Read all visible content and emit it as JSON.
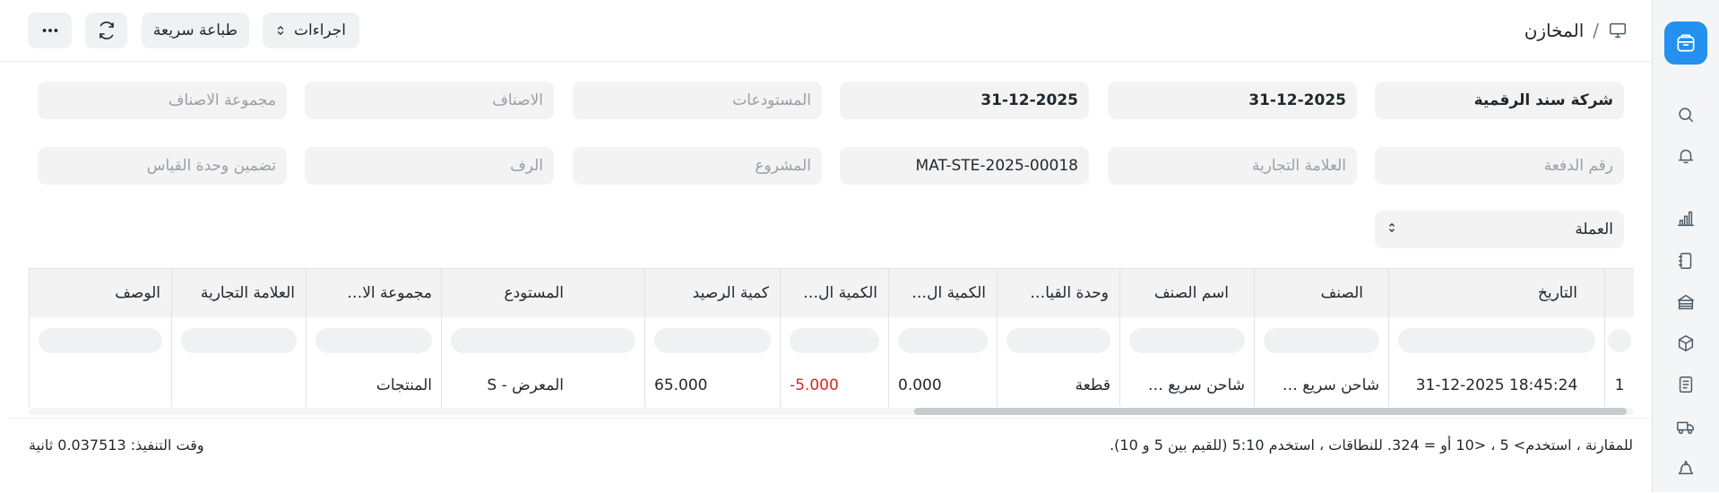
{
  "header": {
    "breadcrumb_title": "المخازن",
    "breadcrumb_separator": "/",
    "actions_label": "اجراءات",
    "quick_print_label": "طباعة سريعة"
  },
  "filters": {
    "row1": [
      {
        "value": "شركة سند الرقمية",
        "placeholder": ""
      },
      {
        "value": "31-12-2025",
        "placeholder": ""
      },
      {
        "value": "31-12-2025",
        "placeholder": ""
      },
      {
        "value": "",
        "placeholder": "المستودعات"
      },
      {
        "value": "",
        "placeholder": "الاصناف"
      },
      {
        "value": "",
        "placeholder": "مجموعة الاصناف"
      }
    ],
    "row2": [
      {
        "value": "",
        "placeholder": "رقم الدفعة"
      },
      {
        "value": "",
        "placeholder": "العلامة التجارية"
      },
      {
        "value": "MAT-STE-2025-00018",
        "placeholder": ""
      },
      {
        "value": "",
        "placeholder": "المشروع"
      },
      {
        "value": "",
        "placeholder": "الرف"
      },
      {
        "value": "",
        "placeholder": "تضمين وحدة القياس"
      }
    ],
    "currency_label": "العملة"
  },
  "table": {
    "columns": [
      "التاريخ",
      "الصنف",
      "اسم الصنف",
      "وحدة القيا…",
      "الكمية ال…",
      "الكمية ال…",
      "كمية الرصيد",
      "المستودع",
      "مجموعة الا…",
      "العلامة التجارية",
      "الوصف"
    ],
    "rows": [
      {
        "index": "1",
        "cells": [
          "31-12-2025 18:45:24",
          "شاحن سريع …",
          "شاحن سريع …",
          "قطعة",
          "0.000",
          "-5.000",
          "65.000",
          "المعرض - S",
          "المنتجات",
          "",
          ""
        ]
      }
    ]
  },
  "footer": {
    "hint": "للمقارنة ، استخدم> 5 ، <10 أو = 324. للنطاقات ، استخدم 5:10 (للقيم بين 5 و 10).",
    "execution_time": "وقت التنفيذ: 0.037513 ثانية"
  },
  "colors": {
    "accent": "#2490ef",
    "negative": "#e02424",
    "field_bg": "#f3f3f3"
  },
  "icons": [
    "app-logo-icon",
    "search-icon",
    "bell-icon",
    "chart-icon",
    "notebook-icon",
    "building-icon",
    "package-icon",
    "document-icon",
    "truck-icon",
    "recycle-icon",
    "monitor-icon",
    "refresh-icon",
    "more-icon",
    "sort-arrows-icon"
  ]
}
